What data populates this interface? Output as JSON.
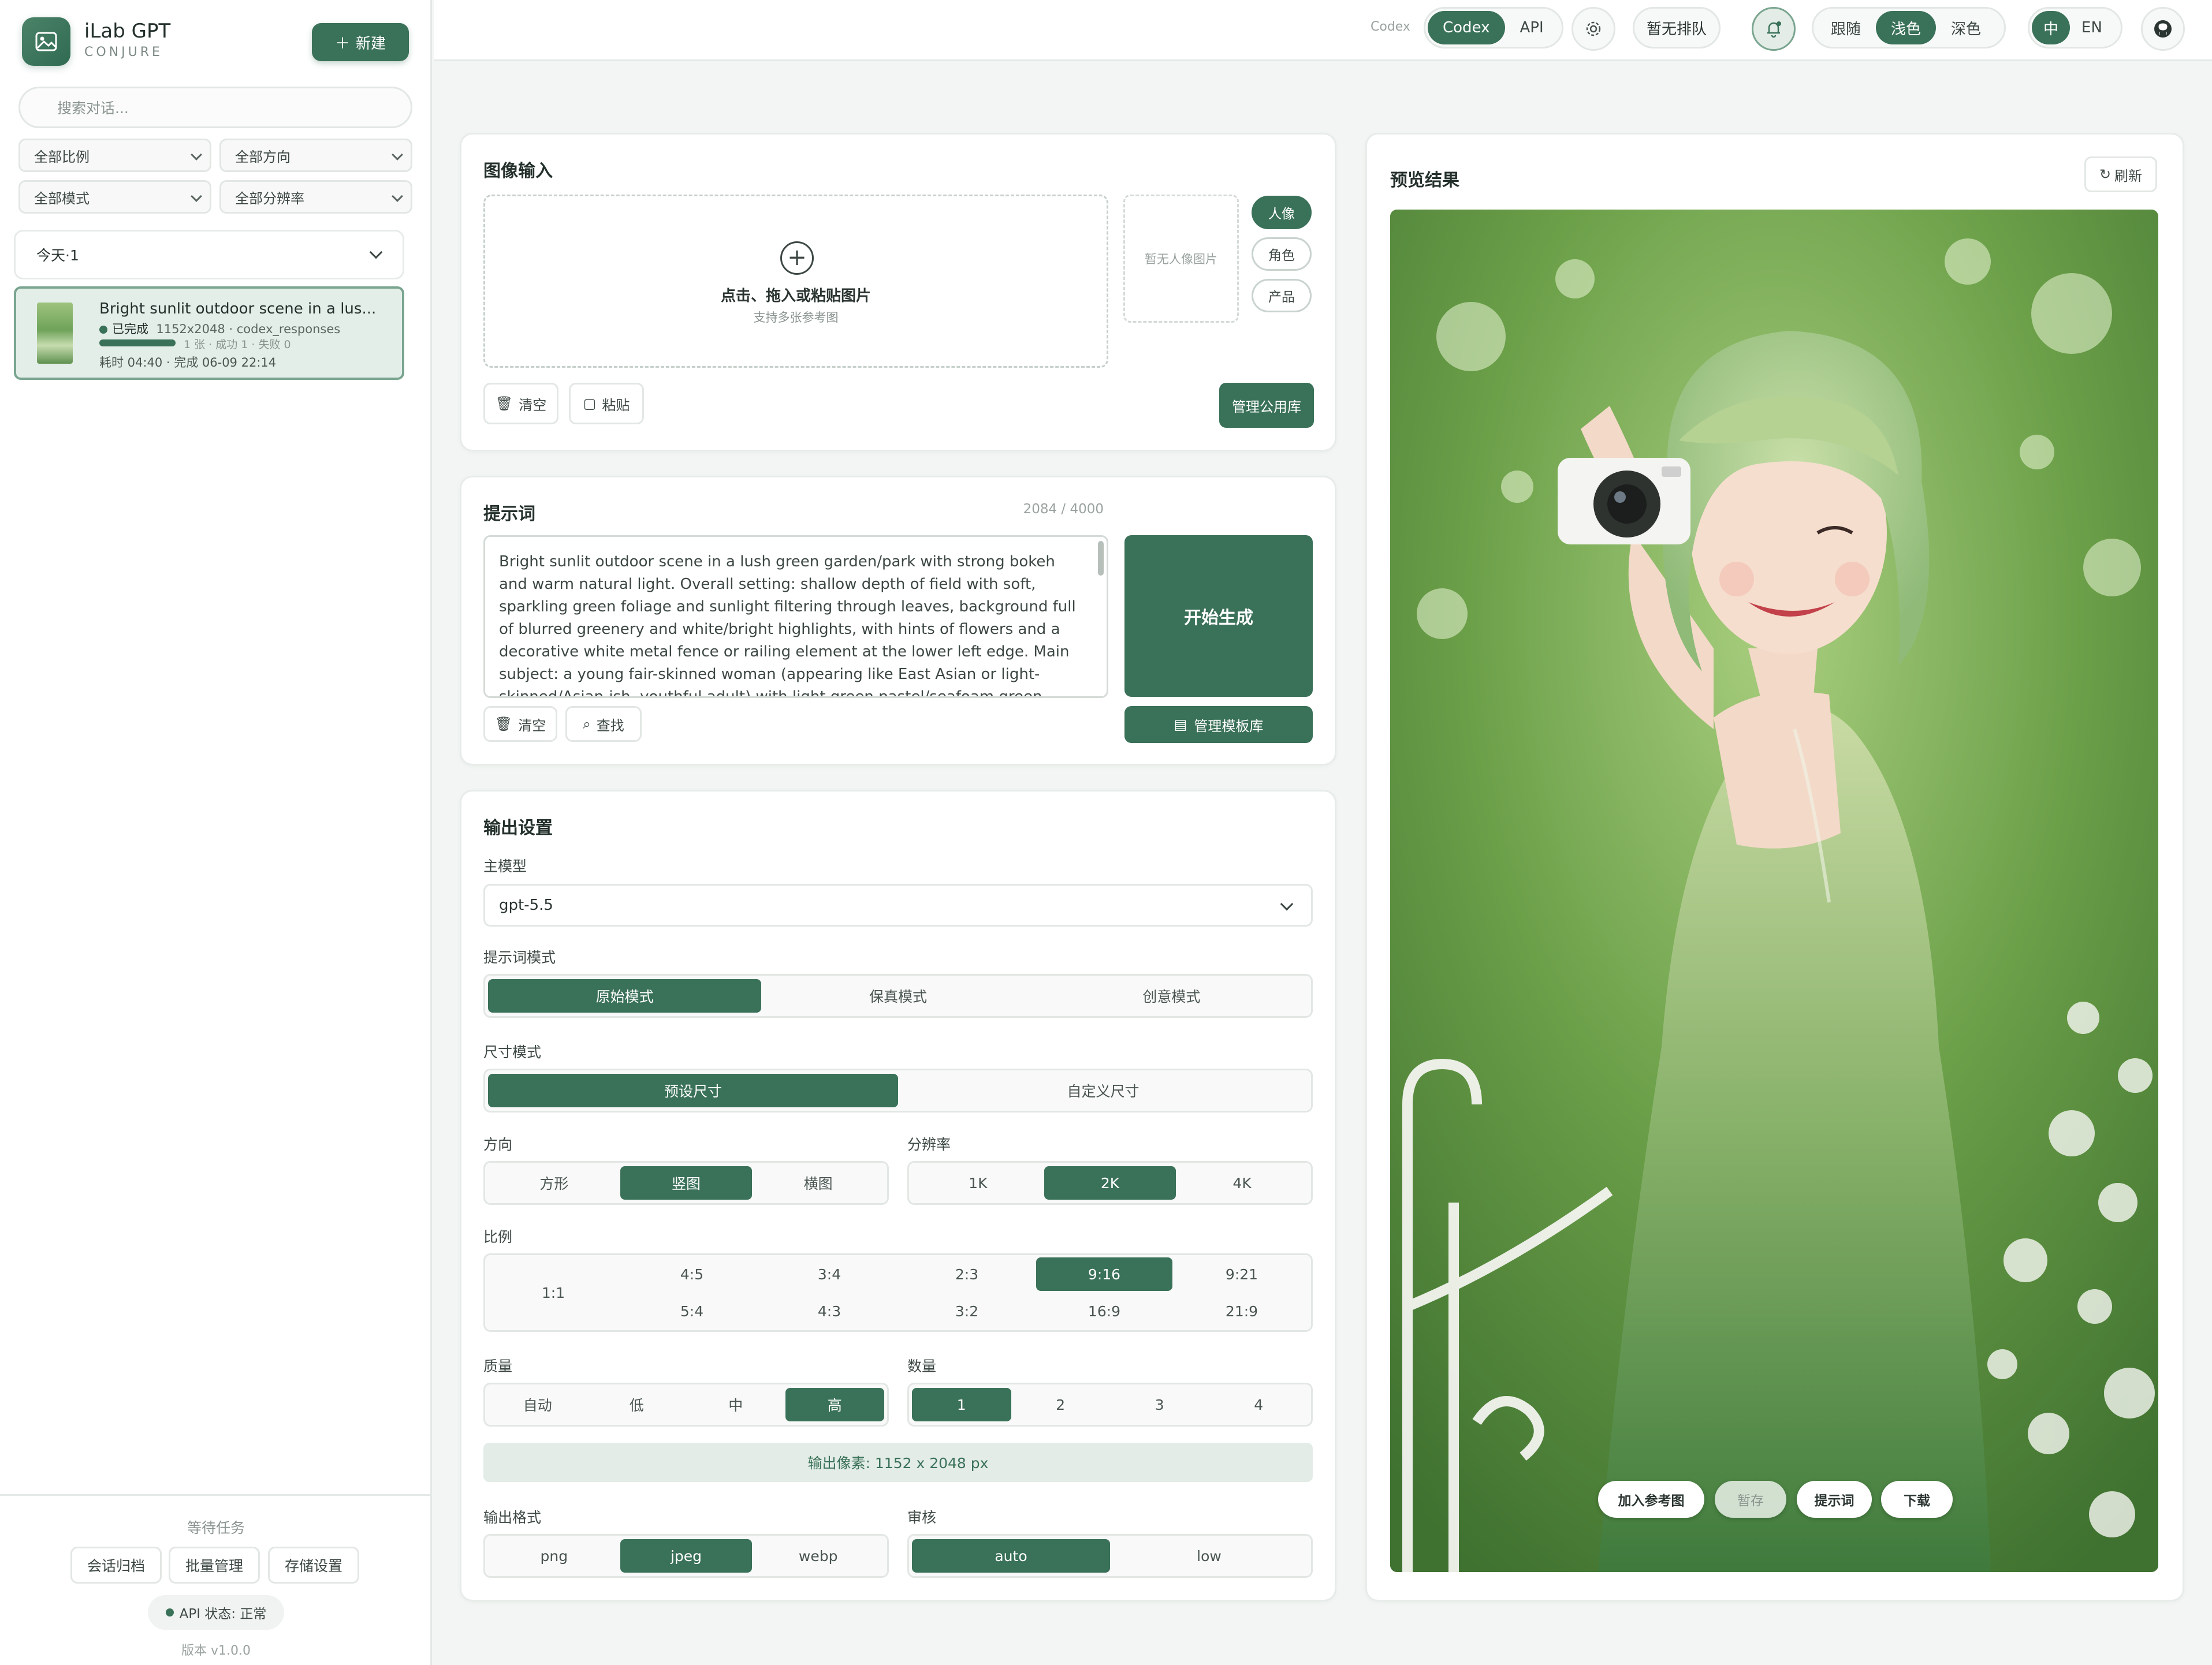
{
  "app": {
    "name": "iLab GPT",
    "subtitle": "CONJURE",
    "new_label": "新建"
  },
  "sidebar": {
    "search_placeholder": "搜索对话...",
    "filters": [
      "全部比例",
      "全部方向",
      "全部模式",
      "全部分辨率"
    ],
    "group_label": "今天·1",
    "history": {
      "title": "Bright sunlit outdoor scene in a lus...",
      "status": "已完成",
      "meta": "1152x2048 · codex_responses",
      "progress": 1,
      "counts": "1 张 · 成功 1 · 失败 0",
      "time": "耗时 04:40 · 完成 06-09 22:14"
    },
    "footer": {
      "waiting": "等待任务",
      "buttons": [
        "会话归档",
        "批量管理",
        "存储设置"
      ],
      "api_status": "API 状态: 正常",
      "version": "版本 v1.0.0"
    }
  },
  "topbar": {
    "mode_caption": "Codex",
    "modes": [
      "Codex",
      "API"
    ],
    "queue": "暂无排队",
    "themes": [
      "跟随",
      "浅色",
      "深色"
    ],
    "langs": [
      "中",
      "EN"
    ],
    "icons": [
      "gear-icon",
      "bell-icon",
      "github-icon"
    ]
  },
  "image_input": {
    "title": "图像输入",
    "drop_text": "点击、拖入或粘贴图片",
    "drop_hint": "支持多张参考图",
    "portrait_empty": "暂无人像图片",
    "chips": [
      "人像",
      "角色",
      "产品"
    ],
    "clear": "清空",
    "paste": "粘贴",
    "manage_library": "管理公用库"
  },
  "prompt": {
    "title": "提示词",
    "count": "2084 / 4000",
    "text": "Bright sunlit outdoor scene in a lush green garden/park with strong bokeh and warm natural light. Overall setting: shallow depth of field with soft, sparkling green foliage and sunlight filtering through leaves, background full of blurred greenery and white/bright highlights, with hints of flowers and a decorative white metal fence or railing element at the lower left edge. Main subject: a young fair-skinned woman (appearing like East Asian or light-skinned/Asian-ish, youthful adult) with light green pastel/seafoam green wavy bob hair and bangs, smiling and winking",
    "generate": "开始生成",
    "clear": "清空",
    "find": "查找",
    "manage_templates": "管理模板库"
  },
  "output": {
    "title": "输出设置",
    "model_label": "主模型",
    "model": "gpt-5.5",
    "prompt_mode_label": "提示词模式",
    "prompt_modes": [
      "原始模式",
      "保真模式",
      "创意模式"
    ],
    "size_mode_label": "尺寸模式",
    "size_modes": [
      "预设尺寸",
      "自定义尺寸"
    ],
    "orientation_label": "方向",
    "orientations": [
      "方形",
      "竖图",
      "横图"
    ],
    "resolution_label": "分辨率",
    "resolutions": [
      "1K",
      "2K",
      "4K"
    ],
    "ratio_label": "比例",
    "ratios": [
      "1:1",
      "4:5",
      "3:4",
      "2:3",
      "9:16",
      "9:21",
      "5:4",
      "4:3",
      "3:2",
      "16:9",
      "21:9"
    ],
    "quality_label": "质量",
    "qualities": [
      "自动",
      "低",
      "中",
      "高"
    ],
    "count_label": "数量",
    "counts": [
      "1",
      "2",
      "3",
      "4"
    ],
    "pixels": "输出像素: 1152 x 2048 px",
    "format_label": "输出格式",
    "formats": [
      "png",
      "jpeg",
      "webp"
    ],
    "moderation_label": "审核",
    "moderations": [
      "auto",
      "low"
    ]
  },
  "preview": {
    "title": "预览结果",
    "refresh": "刷新",
    "actions": [
      "加入参考图",
      "暂存",
      "提示词",
      "下载"
    ]
  },
  "colors": {
    "accent": "#3a7159",
    "accent_light": "#e3ece7",
    "bg": "#f2f5f3"
  }
}
